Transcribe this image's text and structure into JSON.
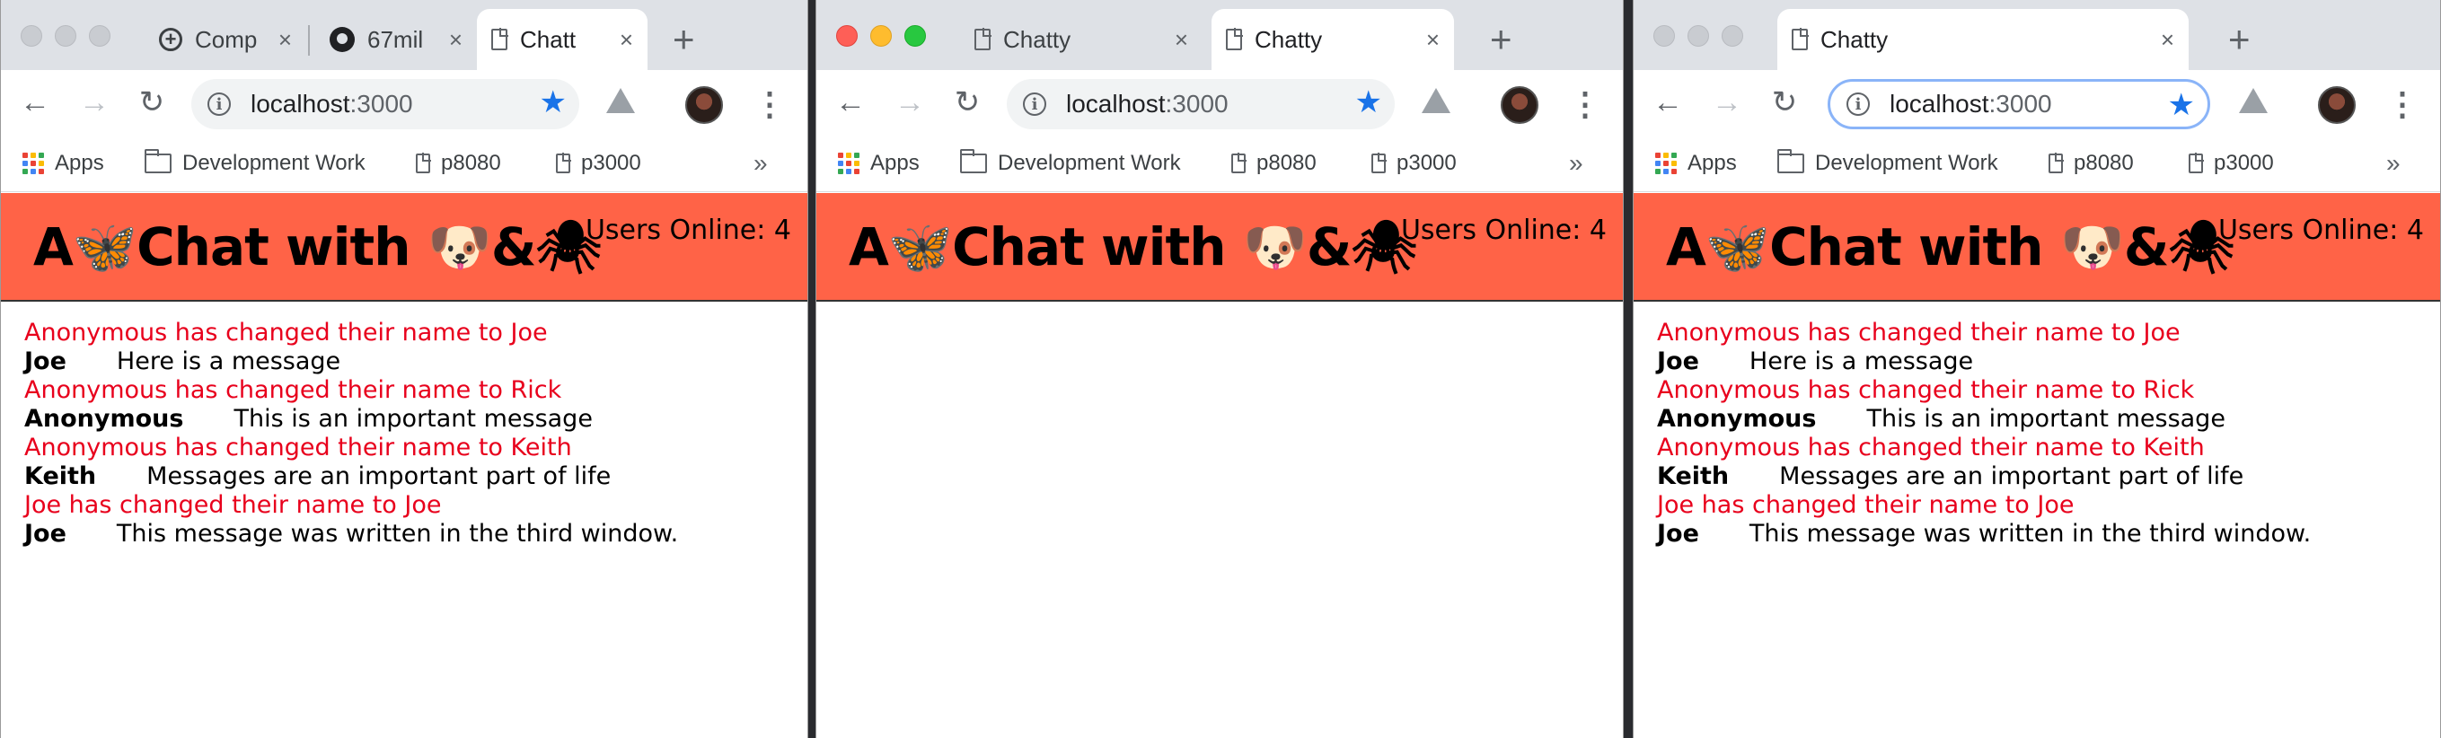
{
  "app": {
    "brand": "A🦋Chat with 🐶&🕷",
    "users_online": "Users Online: 4"
  },
  "browser": {
    "url_host": "localhost",
    "url_port": ":3000",
    "bookmarks": [
      "Apps",
      "Development Work",
      "p8080",
      "p3000"
    ],
    "overflow": "»",
    "new_tab": "+",
    "close": "×",
    "back": "←",
    "forward": "→",
    "reload": "↻",
    "info": "i",
    "star": "★",
    "menu": "⋮"
  },
  "windows": {
    "w1": {
      "tabs": [
        "Comp",
        "67mil",
        "Chatt"
      ]
    },
    "w2": {
      "tabs": [
        "Chatty",
        "Chatty"
      ]
    },
    "w3": {
      "tabs": [
        "Chatty"
      ]
    }
  },
  "messages": [
    {
      "type": "system",
      "text": "Anonymous has changed their name to Joe"
    },
    {
      "type": "user",
      "username": "Joe",
      "text": "Here is a message"
    },
    {
      "type": "system",
      "text": "Anonymous has changed their name to Rick"
    },
    {
      "type": "user",
      "username": "Anonymous",
      "text": "This is an important message"
    },
    {
      "type": "system",
      "text": "Anonymous has changed their name to Keith"
    },
    {
      "type": "user",
      "username": "Keith",
      "text": "Messages are an important part of life"
    },
    {
      "type": "system",
      "text": "Joe has changed their name to Joe"
    },
    {
      "type": "user",
      "username": "Joe",
      "text": "This message was written in the third window."
    }
  ],
  "colors": {
    "header_bg": "#ff6347",
    "system_text": "#e8001c",
    "star": "#1a73e8"
  }
}
